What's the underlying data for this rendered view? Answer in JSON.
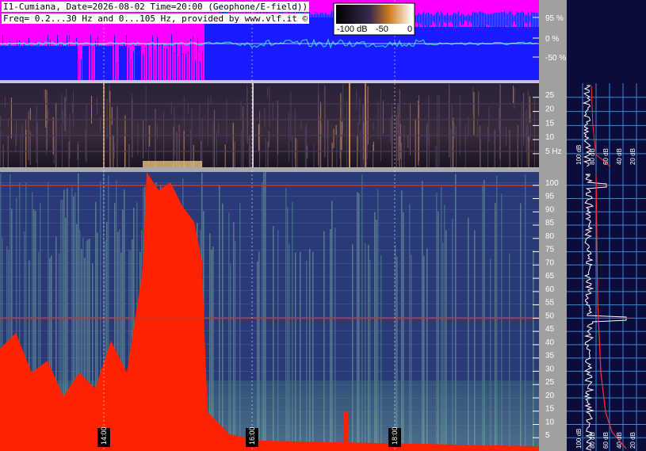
{
  "header": {
    "line1": "I1-Cumiana, Date=2026-08-02 Time=20:00 (Geophone/E-field))",
    "line2": "Freq= 0.2...30 Hz and 0...105 Hz, provided by www.vlf.it ©"
  },
  "colorbar": {
    "labels": [
      "-100 dB",
      "-50",
      "0"
    ]
  },
  "colors": {
    "amplitude_magenta": "#ff00ff",
    "amplitude_blue": "#1a1aff",
    "signal_line": "#22cccc",
    "spectrogram_background": "#2a3a78",
    "hot": "#ff2200",
    "axis_panel": "#a0a0a0",
    "side_panel": "#0b0b3c",
    "grid": "#3a8ad0",
    "spectrum_curve": "#ffffff",
    "fit_curve": "#ff3030"
  },
  "chart_data": [
    {
      "type": "area",
      "panel": "amplitude",
      "y_ticks": [
        "95 %",
        "0 %",
        "-50 %"
      ],
      "ylim": [
        -100,
        100
      ]
    },
    {
      "type": "heatmap",
      "panel": "low-frequency spectrogram",
      "y_ticks": [
        "25",
        "20",
        "15",
        "10",
        "5 Hz"
      ],
      "ylim": [
        0.2,
        30
      ],
      "side_x_ticks": [
        "100 dB",
        "80 dB",
        "60 dB",
        "40 dB",
        "20 dB"
      ]
    },
    {
      "type": "heatmap",
      "panel": "wide-band spectrogram",
      "x_ticks": [
        "14:00",
        "16:00",
        "18:00"
      ],
      "y_ticks": [
        "100",
        "95",
        "90",
        "85",
        "80",
        "75",
        "70",
        "65",
        "60",
        "55",
        "50",
        "45",
        "40",
        "35",
        "30",
        "25",
        "20",
        "15",
        "10",
        "5"
      ],
      "ylim": [
        0,
        105
      ],
      "side_x_ticks": [
        "100 dB",
        "80 dB",
        "60 dB",
        "40 dB",
        "20 dB"
      ],
      "lines_hz": [
        50,
        100
      ]
    }
  ]
}
